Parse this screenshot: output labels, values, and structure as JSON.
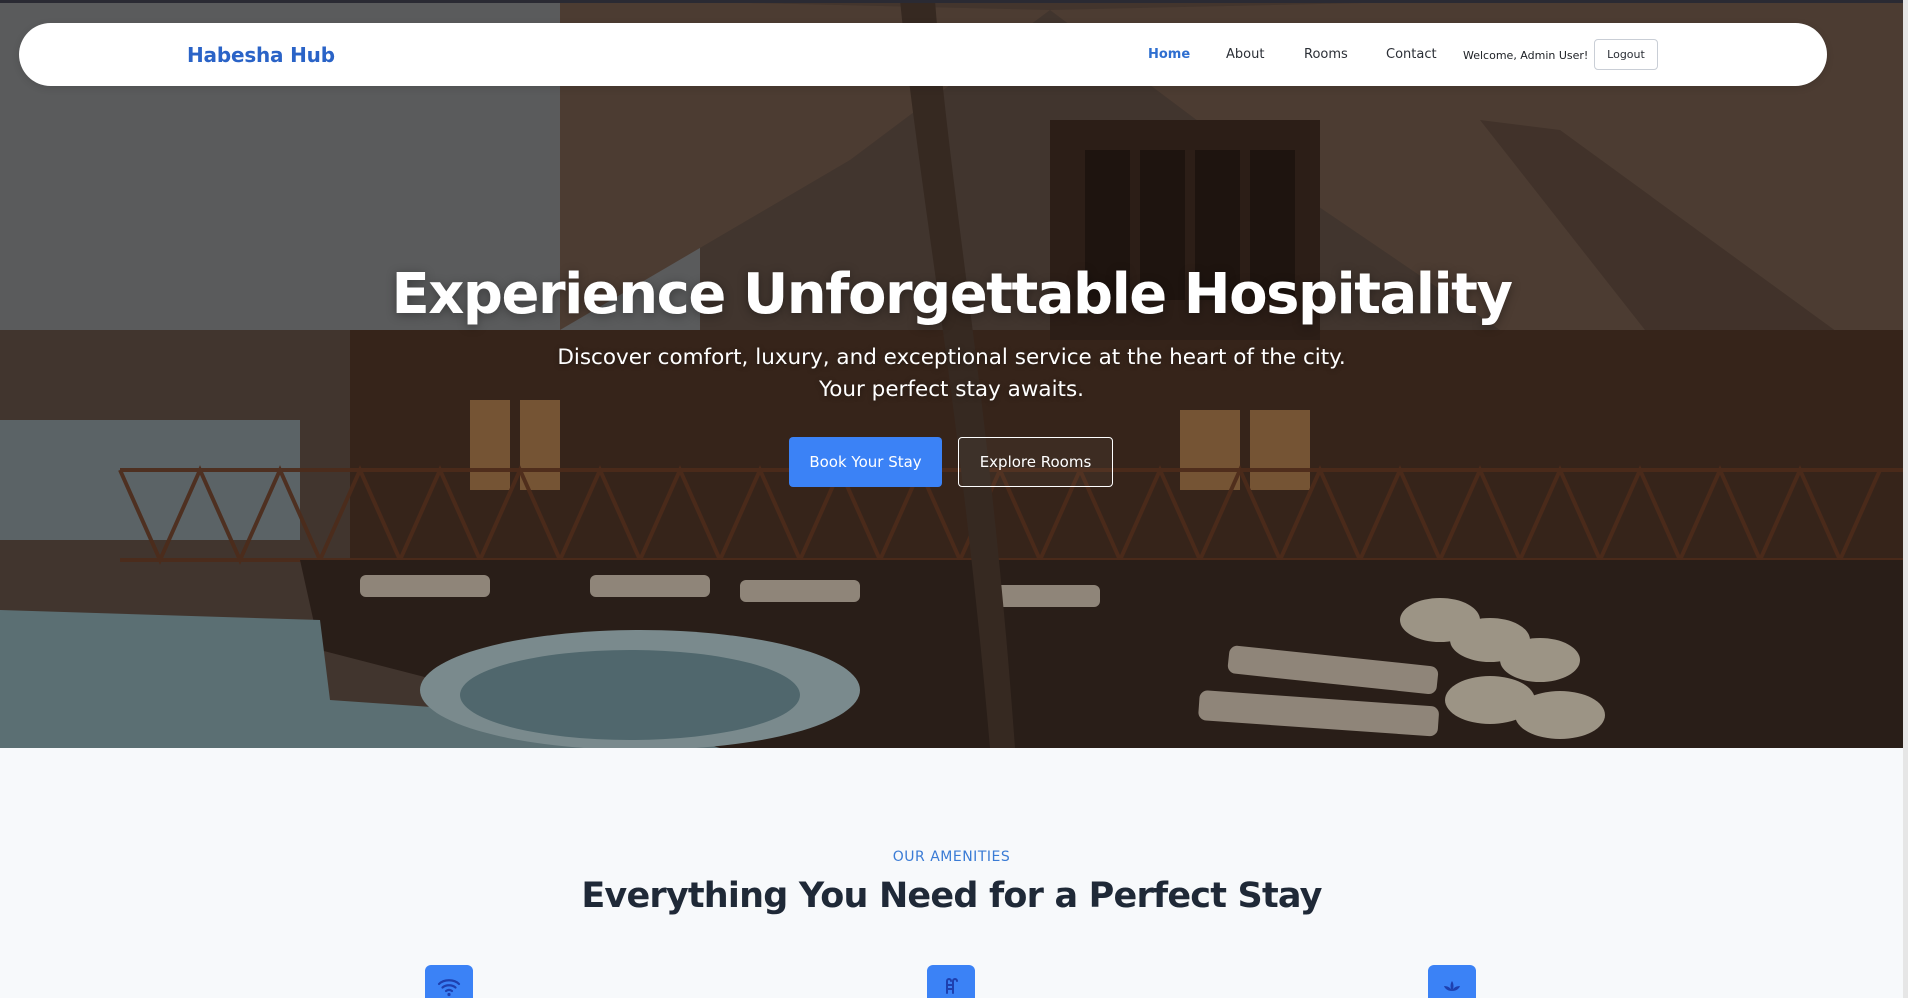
{
  "nav": {
    "brand": "Habesha Hub",
    "links": [
      {
        "label": "Home",
        "active": true
      },
      {
        "label": "About",
        "active": false
      },
      {
        "label": "Rooms",
        "active": false
      },
      {
        "label": "Contact",
        "active": false
      }
    ],
    "welcome": "Welcome, Admin User!",
    "logout_label": "Logout"
  },
  "hero": {
    "title": "Experience Unforgettable Hospitality",
    "subtitle_line1": "Discover comfort, luxury, and exceptional service at the heart of the city.",
    "subtitle_line2": "Your perfect stay awaits.",
    "primary_button": "Book Your Stay",
    "secondary_button": "Explore Rooms"
  },
  "amenities": {
    "kicker": "OUR AMENITIES",
    "title": "Everything You Need for a Perfect Stay",
    "icons": [
      "wifi-icon",
      "pool-icon",
      "spa-icon"
    ]
  },
  "colors": {
    "brand": "#2a63c7",
    "accent": "#3b82f6",
    "active_link": "#2f6fd0",
    "heading_dark": "#1f2937",
    "section_bg": "#f7f9fb"
  }
}
